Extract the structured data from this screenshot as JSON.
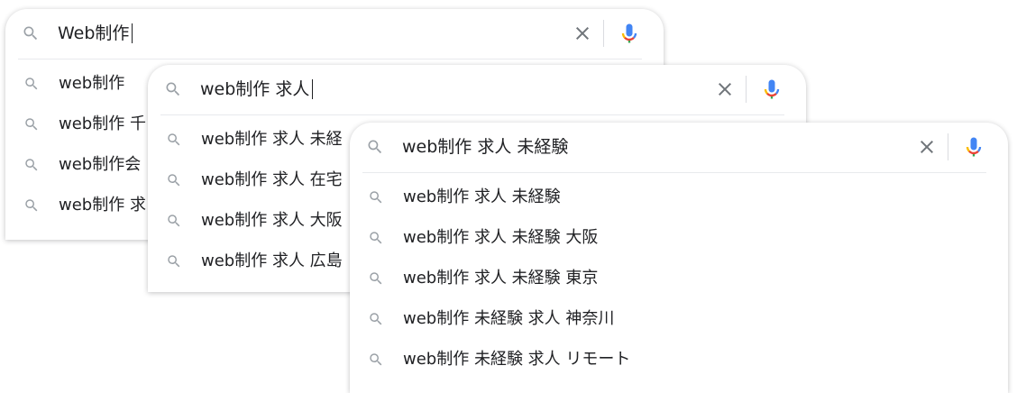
{
  "colors": {
    "text": "#202124",
    "icon_gray": "#9aa0a6",
    "clear_gray": "#70757a",
    "mic_blue": "#4285f4",
    "mic_red": "#ea4335",
    "mic_yellow": "#fbbc04",
    "mic_green": "#34a853"
  },
  "icons": {
    "search": "search-icon",
    "clear": "close-icon",
    "mic": "microphone-icon"
  },
  "panels": [
    {
      "query": "Web制作",
      "suggestions": [
        "web制作",
        "web制作 千",
        "web制作会",
        "web制作 求"
      ]
    },
    {
      "query": "web制作 求人",
      "suggestions": [
        "web制作 求人 未経",
        "web制作 求人 在宅",
        "web制作 求人 大阪",
        "web制作 求人 広島"
      ]
    },
    {
      "query": "web制作 求人 未経験",
      "suggestions": [
        "web制作 求人 未経験",
        "web制作 求人 未経験 大阪",
        "web制作 求人 未経験 東京",
        "web制作 未経験 求人 神奈川",
        "web制作 未経験 求人 リモート"
      ]
    }
  ]
}
